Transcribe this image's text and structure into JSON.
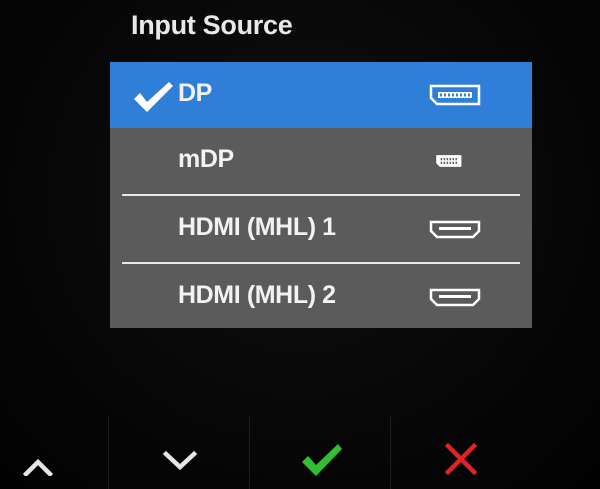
{
  "menu": {
    "title": "Input Source",
    "items": [
      {
        "label": "DP",
        "selected": true,
        "icon": "displayport-icon"
      },
      {
        "label": "mDP",
        "selected": false,
        "icon": "mini-displayport-icon"
      },
      {
        "label": "HDMI (MHL) 1",
        "selected": false,
        "icon": "hdmi-icon"
      },
      {
        "label": "HDMI (MHL) 2",
        "selected": false,
        "icon": "hdmi-icon"
      }
    ]
  },
  "buttons": [
    {
      "name": "up",
      "icon": "chevron-up-icon",
      "color": "#e6e6e6"
    },
    {
      "name": "down",
      "icon": "chevron-down-icon",
      "color": "#e6e6e6"
    },
    {
      "name": "confirm",
      "icon": "checkmark-icon",
      "color": "#2fbf2f"
    },
    {
      "name": "exit",
      "icon": "close-icon",
      "color": "#e02424"
    }
  ],
  "colors": {
    "selected_background": "#2f7fd8",
    "list_background": "#5b5b5b"
  }
}
